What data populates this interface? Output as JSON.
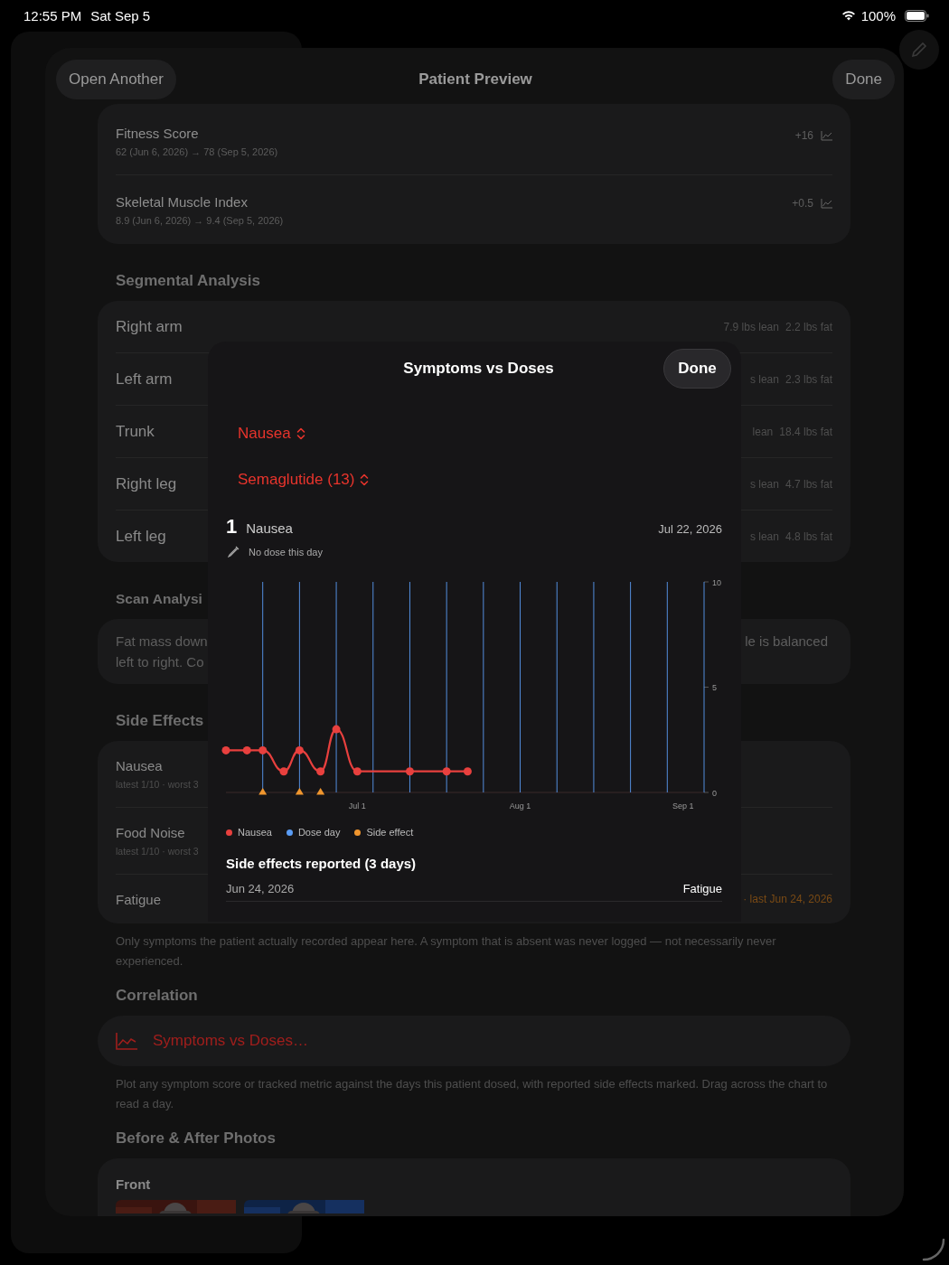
{
  "status_bar": {
    "time": "12:55 PM",
    "date": "Sat Sep 5",
    "battery": "100%"
  },
  "sheet": {
    "title": "Patient Preview",
    "left_button": "Open Another",
    "right_button": "Done",
    "metrics": [
      {
        "name": "Fitness Score",
        "detail": "62 (Jun 6, 2026) → 78 (Sep 5, 2026)",
        "change": "+16"
      },
      {
        "name": "Skeletal Muscle Index",
        "detail": "8.9 (Jun 6, 2026) → 9.4 (Sep 5, 2026)",
        "change": "+0.5"
      }
    ],
    "segmental": {
      "title": "Segmental Analysis",
      "rows": [
        {
          "label": "Right arm",
          "lean": "7.9 lbs lean",
          "fat": "2.2 lbs fat"
        },
        {
          "label": "Left arm",
          "lean": "s lean",
          "fat": "2.3 lbs fat"
        },
        {
          "label": "Trunk",
          "lean": "lean",
          "fat": "18.4 lbs fat"
        },
        {
          "label": "Right leg",
          "lean": "s lean",
          "fat": "4.7 lbs fat"
        },
        {
          "label": "Left leg",
          "lean": "s lean",
          "fat": "4.8 lbs fat"
        }
      ]
    },
    "scan": {
      "title": "Scan Analysi",
      "lines": [
        {
          "start": "Fat mass down",
          "end": "le is balanced"
        },
        {
          "start": "left to right. Co"
        }
      ]
    },
    "side_effects": {
      "title": "Side Effects",
      "rows": [
        {
          "name": "Nausea",
          "detail": "latest 1/10 · worst 3"
        },
        {
          "name": "Food Noise",
          "detail": "latest 1/10 · worst 3"
        },
        {
          "name": "Fatigue",
          "last": "· last Jun 24, 2026"
        }
      ],
      "note": "Only symptoms the patient actually recorded appear here. A symptom that is absent was never logged — not necessarily never experienced."
    },
    "correlation": {
      "title": "Correlation",
      "button": "Symptoms vs Doses…",
      "note": "Plot any symptom score or tracked metric against the days this patient dosed, with reported side effects marked. Drag across the chart to read a day."
    },
    "photos": {
      "title": "Before & After Photos",
      "groups": [
        {
          "label": "Front"
        }
      ]
    }
  },
  "symptoms_modal": {
    "title": "Symptoms vs Doses",
    "done": "Done",
    "pickers": [
      {
        "label": "Nausea"
      },
      {
        "label": "Semaglutide (13)"
      }
    ],
    "readout": {
      "value": "1",
      "name": "Nausea",
      "date": "Jul 22, 2026",
      "dose_note": "No dose this day"
    },
    "chart_data": {
      "type": "line",
      "xlim": [
        "2026-06-06",
        "2026-09-05"
      ],
      "ylim": [
        0,
        10
      ],
      "yticks": [
        0,
        5,
        10
      ],
      "xticks": [
        {
          "value": "2026-07-01",
          "label": "Jul 1"
        },
        {
          "value": "2026-08-01",
          "label": "Aug 1"
        },
        {
          "value": "2026-09-01",
          "label": "Sep 1"
        }
      ],
      "x": [
        "2026-06-06",
        "2026-06-10",
        "2026-06-13",
        "2026-06-17",
        "2026-06-20",
        "2026-06-24",
        "2026-06-27",
        "2026-07-01",
        "2026-07-11",
        "2026-07-18",
        "2026-07-22"
      ],
      "series": [
        {
          "name": "Nausea",
          "color": "#e8403e",
          "marker": "circle",
          "values": [
            2,
            2,
            2,
            1,
            2,
            1,
            3,
            1,
            1,
            1,
            1
          ]
        },
        {
          "name": "Side effect",
          "color": "#f0962e",
          "marker": "triangle",
          "type": "scatter",
          "values": [
            null,
            null,
            0,
            null,
            0,
            0,
            null,
            null,
            null,
            null,
            null
          ]
        }
      ],
      "ref_lines": [
        {
          "axis": "x",
          "value": "2026-06-13"
        },
        {
          "axis": "x",
          "value": "2026-06-20"
        },
        {
          "axis": "x",
          "value": "2026-06-27"
        },
        {
          "axis": "x",
          "value": "2026-07-04"
        },
        {
          "axis": "x",
          "value": "2026-07-11"
        },
        {
          "axis": "x",
          "value": "2026-07-18"
        },
        {
          "axis": "x",
          "value": "2026-07-25"
        },
        {
          "axis": "x",
          "value": "2026-08-01"
        },
        {
          "axis": "x",
          "value": "2026-08-08"
        },
        {
          "axis": "x",
          "value": "2026-08-15"
        },
        {
          "axis": "x",
          "value": "2026-08-22"
        },
        {
          "axis": "x",
          "value": "2026-08-29"
        },
        {
          "axis": "x",
          "value": "2026-09-05"
        }
      ]
    },
    "dose_legend": {
      "label": "Dose day",
      "color": "#5a9cf5"
    },
    "side_effects_title": "Side effects reported (3 days)",
    "side_effects": [
      {
        "date": "Jun 24, 2026",
        "name": "Fatigue"
      }
    ]
  }
}
